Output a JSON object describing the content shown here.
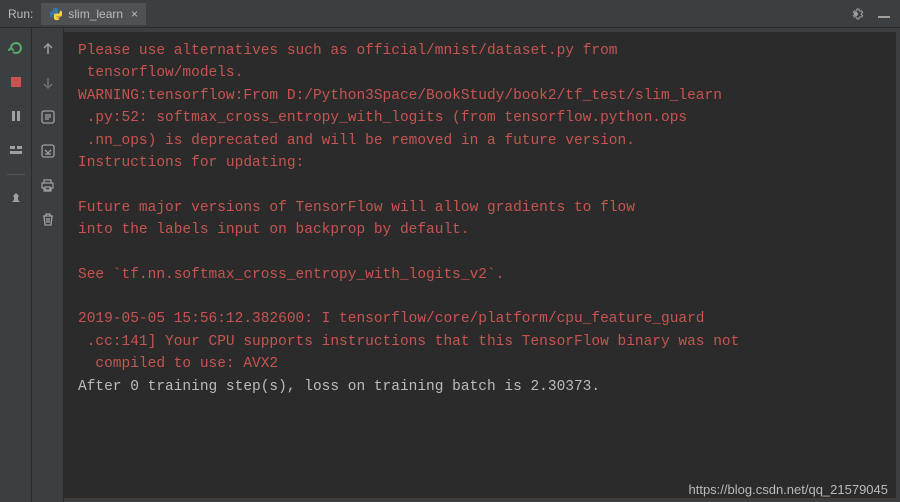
{
  "header": {
    "run_label": "Run:",
    "tab_label": "slim_learn",
    "tab_close": "×"
  },
  "console": {
    "lines": [
      {
        "type": "error",
        "text": "Please use alternatives such as official/mnist/dataset.py from"
      },
      {
        "type": "error",
        "text": " tensorflow/models."
      },
      {
        "type": "error",
        "text": "WARNING:tensorflow:From D:/Python3Space/BookStudy/book2/tf_test/slim_learn"
      },
      {
        "type": "error",
        "text": " .py:52: softmax_cross_entropy_with_logits (from tensorflow.python.ops"
      },
      {
        "type": "error",
        "text": " .nn_ops) is deprecated and will be removed in a future version."
      },
      {
        "type": "error",
        "text": "Instructions for updating:"
      },
      {
        "type": "blank",
        "text": ""
      },
      {
        "type": "error",
        "text": "Future major versions of TensorFlow will allow gradients to flow"
      },
      {
        "type": "error",
        "text": "into the labels input on backprop by default."
      },
      {
        "type": "blank",
        "text": ""
      },
      {
        "type": "error",
        "text": "See `tf.nn.softmax_cross_entropy_with_logits_v2`."
      },
      {
        "type": "blank",
        "text": ""
      },
      {
        "type": "error",
        "text": "2019-05-05 15:56:12.382600: I tensorflow/core/platform/cpu_feature_guard"
      },
      {
        "type": "error",
        "text": " .cc:141] Your CPU supports instructions that this TensorFlow binary was not"
      },
      {
        "type": "error",
        "text": "  compiled to use: AVX2"
      },
      {
        "type": "normal",
        "text": "After 0 training step(s), loss on training batch is 2.30373."
      }
    ]
  },
  "watermark": "https://blog.csdn.net/qq_21579045"
}
